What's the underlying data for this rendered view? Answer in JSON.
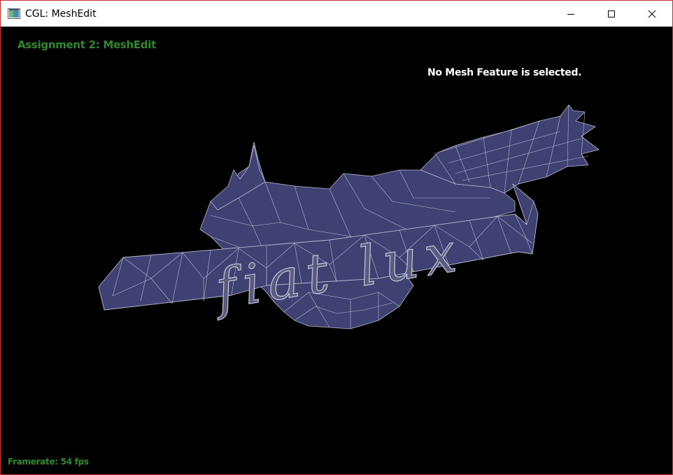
{
  "window": {
    "title": "CGL: MeshEdit",
    "icon": "app-window-icon",
    "controls": [
      "minimize-icon",
      "maximize-icon",
      "close-icon"
    ]
  },
  "viewport": {
    "assignment_title": "Assignment 2: MeshEdit",
    "selection_status": "No Mesh Feature is selected.",
    "framerate": "Framerate: 54 fps",
    "mesh_banner_text": "fiat lux",
    "colors": {
      "background": "#000000",
      "overlay_green": "#2f8a2f",
      "mesh_fill": "#3f4172",
      "mesh_edges": "#b7b9cf"
    }
  }
}
